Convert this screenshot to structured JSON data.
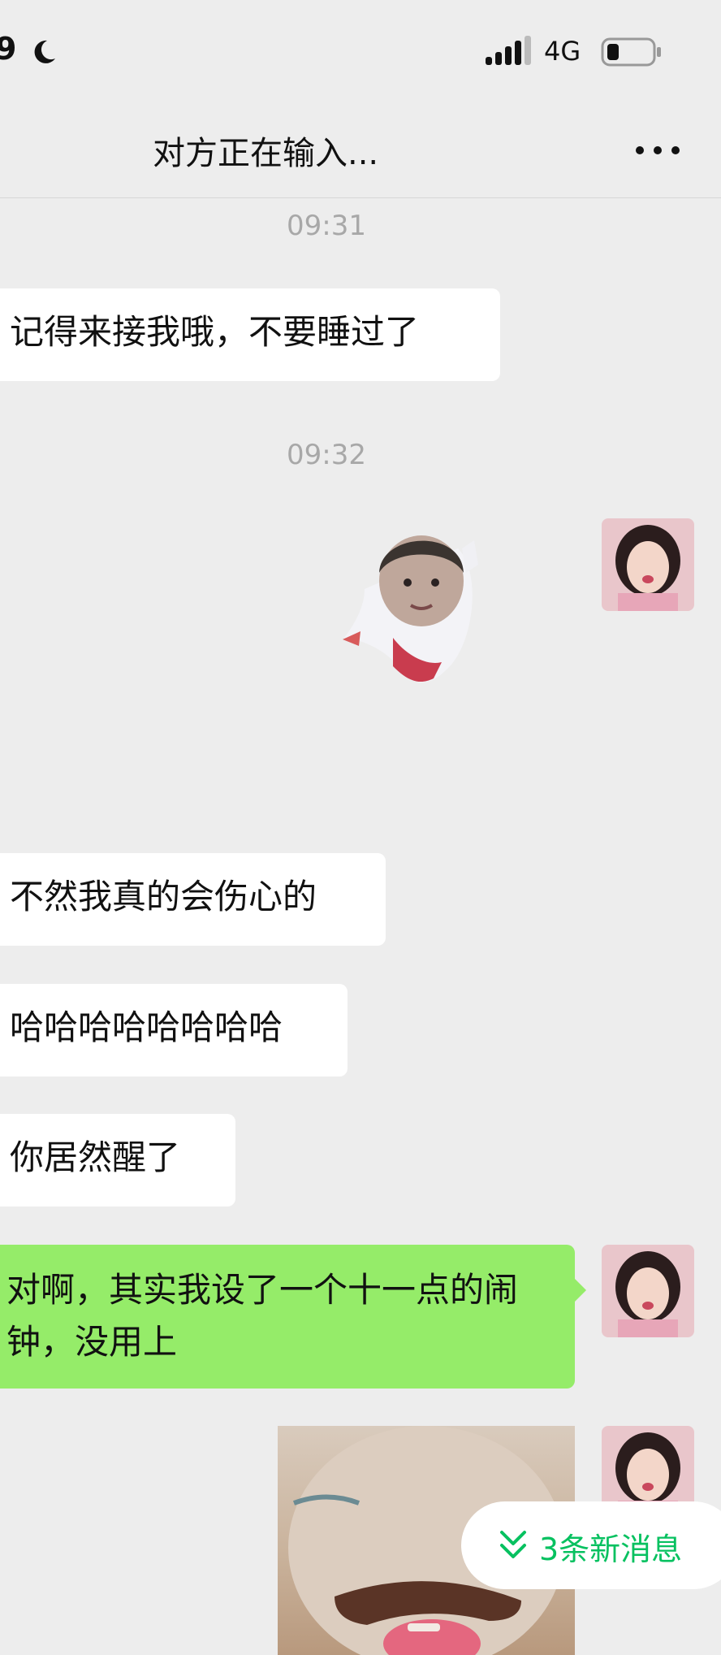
{
  "status_bar": {
    "time": "9",
    "network": "4G",
    "icons": [
      "moon-icon",
      "signal-icon",
      "battery-icon"
    ]
  },
  "header": {
    "title": "对方正在输入...",
    "more_icon": "more-icon"
  },
  "messages": [
    {
      "type": "timestamp",
      "text": "09:31"
    },
    {
      "type": "text",
      "side": "left",
      "text": "记得来接我哦，不要睡过了"
    },
    {
      "type": "timestamp",
      "text": "09:32"
    },
    {
      "type": "sticker",
      "side": "right"
    },
    {
      "type": "text",
      "side": "left",
      "text": "不然我真的会伤心的"
    },
    {
      "type": "text",
      "side": "left",
      "text": "哈哈哈哈哈哈哈哈"
    },
    {
      "type": "text",
      "side": "left",
      "text": "你居然醒了"
    },
    {
      "type": "text",
      "side": "right",
      "text": "对啊，其实我设了一个十一点的闹钟，没用上"
    },
    {
      "type": "image",
      "side": "right"
    }
  ],
  "new_messages": {
    "label": "3条新消息",
    "icon": "double-chevron-down-icon"
  },
  "colors": {
    "background": "#ededed",
    "outgoing_bubble": "#95ec69",
    "incoming_bubble": "#ffffff",
    "accent": "#07c160"
  }
}
